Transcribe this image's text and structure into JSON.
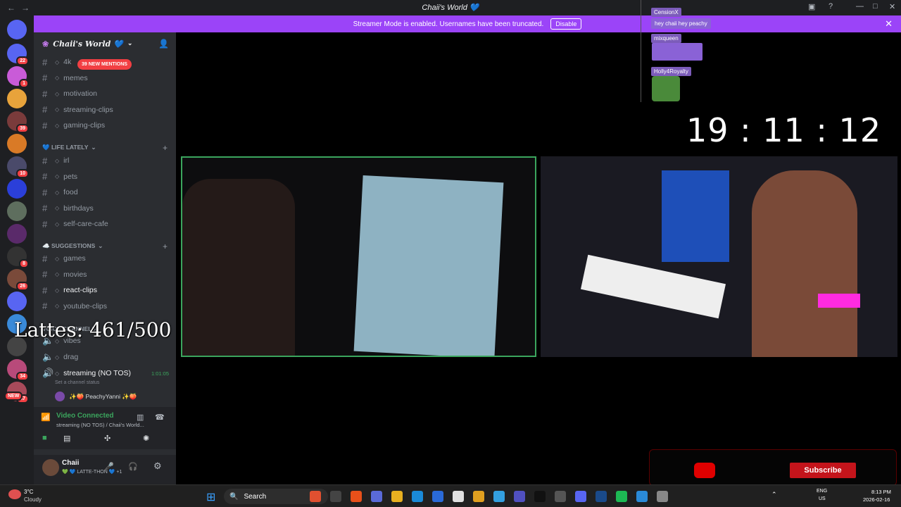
{
  "window": {
    "title": "Chaii's World 💙",
    "back": "←",
    "forward": "→"
  },
  "banner": {
    "text": "Streamer Mode is enabled. Usernames have been truncated.",
    "button": "Disable",
    "close": "✕"
  },
  "rail": {
    "servers": [
      {
        "badge": "22",
        "color": "#5865f2"
      },
      {
        "badge": "1",
        "color": "#c95bd8"
      },
      {
        "badge": "",
        "color": "#e8a33b"
      },
      {
        "badge": "39",
        "color": "#7a3b3b"
      },
      {
        "badge": "",
        "color": "#d97a26"
      },
      {
        "badge": "10",
        "color": "#4a4a6a"
      },
      {
        "badge": "",
        "color": "#2b3fd9"
      },
      {
        "badge": "",
        "color": "#5e6e5e"
      },
      {
        "badge": "",
        "color": "#5a2a6a"
      },
      {
        "badge": "8",
        "color": "#333"
      },
      {
        "badge": "26",
        "color": "#7a4a3a"
      },
      {
        "badge": "",
        "color": "#5865f2"
      },
      {
        "badge": "",
        "color": "#3a8ad9"
      },
      {
        "badge": "",
        "color": "#444"
      },
      {
        "badge": "34",
        "color": "#b84a7a"
      },
      {
        "badge": "47",
        "color": "#a84a5a"
      }
    ],
    "new_label": "NEW"
  },
  "sidebar": {
    "server_name": "Chaii's World 💙",
    "mentions": "39 NEW MENTIONS",
    "channels_top": [
      "4k",
      "memes",
      "motivation",
      "streaming-clips",
      "gaming-clips"
    ],
    "category_life": "💙 LIFE LATELY",
    "channels_life": [
      "irl",
      "pets",
      "food",
      "birthdays",
      "self-care-cafe"
    ],
    "category_suggestions": "☁️ SUGGESTIONS",
    "channels_suggestions": [
      "games",
      "movies",
      "react-clips",
      "youtube-clips"
    ],
    "category_voice": "VOICE CHANNELS",
    "voice_channels": [
      "vibes",
      "drag"
    ],
    "streaming_channel": "streaming (NO TOS)",
    "streaming_time": "1:01:05",
    "channel_status": "Set a channel status",
    "member": "✨🍑 PeachyYanni ✨🍑"
  },
  "voice_panel": {
    "status": "Video Connected",
    "detail": "streaming (NO TOS) / Chaii's World..."
  },
  "user_panel": {
    "name": "Chaii",
    "status": "💚 💙 LATTE-THON 💙 +1"
  },
  "overlay": {
    "lattes": "Lattes: 461/500",
    "clock": "19 : 11 : 12",
    "chat": [
      {
        "name": "CensionX"
      },
      {
        "message": "hey chaii hey peachy"
      },
      {
        "name": "mixqueen"
      },
      {
        "name": "Holly4Royalty"
      }
    ],
    "subscribe": "Subscribe"
  },
  "taskbar": {
    "weather_temp": "3°C",
    "weather_desc": "Cloudy",
    "search": "Search",
    "lang": "ENG",
    "region": "US",
    "time": "8:13 PM",
    "date": "2026-02-16"
  },
  "colors": {
    "accent": "#9b44f8",
    "discord_bg": "#2b2d31",
    "connected": "#3ba55d",
    "youtube": "#c4141b"
  }
}
